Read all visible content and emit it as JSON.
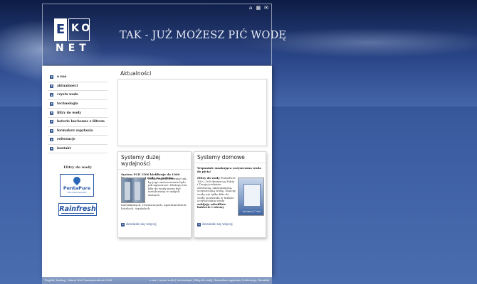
{
  "header": {
    "logo": {
      "e": "E",
      "ko": "KO",
      "net": "NET"
    },
    "slogan": "TAK - JUŻ MOŻESZ PIĆ WODĘ",
    "icons": [
      "home-icon",
      "sitemap-icon",
      "mail-icon"
    ]
  },
  "nav": {
    "items": [
      "o nas",
      "aktualności",
      "czysta woda",
      "technologia",
      "filtry do wody",
      "baterie kuchenne z filtrem",
      "formularz zapytania",
      "referencje",
      "kontakt"
    ]
  },
  "filters": {
    "title": "Filtry do wody",
    "pentapure_name": "PentaPure",
    "pentapure_sub": "TECHNOLOGIES",
    "rainfresh_name": "Rainfresh"
  },
  "news": {
    "title": "Aktualności"
  },
  "panels": {
    "left": {
      "title": "Systemy dużej wydajności",
      "lead": "System PCR 1500 kiefiltruje do 1000 litrów smacznej wody na godzinę.",
      "text1": "Został zaprojektowany tak, by jego zastosowanie było jak najszersze. Dlatego ten filtr do wody może być instalowany w małych domach",
      "text2": "mieszkalnych, restauracjach, apartamentach, hotelach, szpitalach.",
      "more": "dowiedz się więcej"
    },
    "right": {
      "title": "Systemy domowe",
      "lead": "Wspaniale smakująca oczyszczona woda do picia!",
      "text_bold": "Filtry do wody",
      "text": " PentaPure 100 i 200 dostarczą Tobie i Twojej rodzinie zdrowszą, smaczniejszą, oczyszczoną wodę. Znaczy wodę nie tylko filtr do wody, pozawala w trakcie oczyszczania wody",
      "text_bold2": "zabijają szkodliwe bakterie i wirusy",
      "img_caption": "PentaPure™ 200",
      "more": "dowiedz się więcej"
    }
  },
  "footer": {
    "left": "Projekt, hosting - Manet Net Communications 2006",
    "right": "o nas | czysta woda | technologia | filtry do wody | formularz zapytania | referencje | kontakt"
  },
  "colors": {
    "accent": "#3a5a92",
    "link": "#2a4a8a",
    "footer": "#8da2c8"
  }
}
